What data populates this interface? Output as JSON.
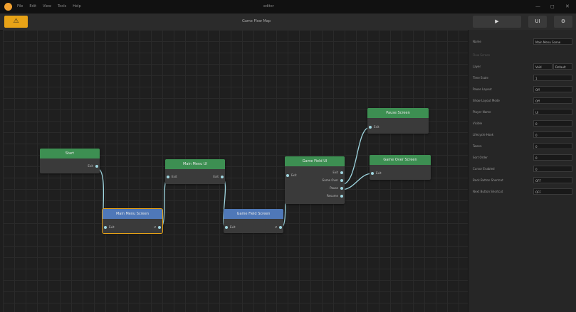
{
  "titlebar": {
    "menu": [
      "File",
      "Edit",
      "View",
      "Tools",
      "Help"
    ],
    "title": "editor",
    "controls": [
      "—",
      "◻",
      "✕"
    ]
  },
  "toolbar": {
    "warning_icon": "⚠",
    "flow_title": "Game Flow Map",
    "play_icon": "▶",
    "btn2_label": "UI",
    "btn3_icon": "⚙"
  },
  "nodes": {
    "start": {
      "title": "Start",
      "out": "Exit"
    },
    "main_menu_screen": {
      "title": "Main Menu Screen",
      "in": "Exit",
      "out": "↺"
    },
    "main_menu_ui": {
      "title": "Main Menu UI",
      "in": "Exit",
      "out": "Exit"
    },
    "game_field_screen": {
      "title": "Game Field Screen",
      "in": "Exit",
      "out": "↺"
    },
    "game_field_ui": {
      "title": "Game Field UI",
      "in": "Exit",
      "outs": [
        "Exit",
        "Game Over",
        "Pause",
        "Resume"
      ]
    },
    "pause_screen": {
      "title": "Pause Screen",
      "in": "Exit"
    },
    "game_over_screen": {
      "title": "Game Over Screen",
      "in": "Exit"
    }
  },
  "panel": {
    "name_label": "Name",
    "name_value": "Main Menu Scene",
    "section_label": "Flow Screen",
    "rows": [
      {
        "label": "Layer",
        "value": "Void",
        "value2": "Default"
      },
      {
        "label": "Time Scale",
        "value": "1"
      },
      {
        "label": "Pause Layout",
        "value": "Off"
      },
      {
        "label": "Show Layout Mode",
        "value": "Off"
      },
      {
        "label": "Player Name",
        "value": "UI"
      },
      {
        "label": "Visible",
        "value": "0"
      },
      {
        "label": "Lifecycle Hook",
        "value": "0"
      },
      {
        "label": "Tween",
        "value": "0"
      },
      {
        "label": "Sort Order",
        "value": "0"
      },
      {
        "label": "Cursor Enabled",
        "value": "0"
      },
      {
        "label": "Back Button Shortcut",
        "value": "OFF"
      },
      {
        "label": "Next Button Shortcut",
        "value": "OFF"
      }
    ]
  },
  "colors": {
    "accent": "#e8a317",
    "node_green": "#3d8f52",
    "node_blue": "#4f78b8",
    "wire": "#9fd6e0"
  }
}
